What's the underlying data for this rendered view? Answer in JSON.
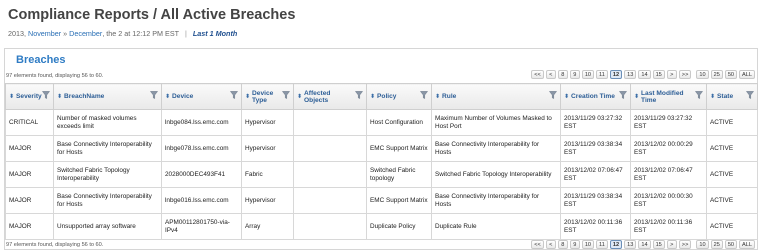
{
  "header": {
    "title": "Compliance Reports / All Active Breaches",
    "date_prefix": "2013,",
    "date_from": "November",
    "date_arrow": "»",
    "date_to": "December",
    "date_suffix": ", the 2 at 12:12 PM EST",
    "separator": "|",
    "period": "Last 1 Month"
  },
  "section": {
    "title": "Breaches"
  },
  "info": {
    "top": "97 elements found, displaying 56 to 60.",
    "bottom": "97 elements found, displaying 56 to 60."
  },
  "pager": {
    "first": "<<",
    "prev": "<",
    "pages": [
      "8",
      "9",
      "10",
      "11",
      "12",
      "13",
      "14",
      "15"
    ],
    "current": "12",
    "next": ">",
    "last": ">>",
    "sizes": [
      "10",
      "25",
      "50",
      "ALL"
    ]
  },
  "table": {
    "columns": [
      {
        "label": "Severity",
        "sort": "sorted"
      },
      {
        "label": "BreachName",
        "sort": "sortable"
      },
      {
        "label": "Device",
        "sort": "sortable"
      },
      {
        "label": "Device Type",
        "sort": "sortable"
      },
      {
        "label": "Affected Objects",
        "sort": "sortable"
      },
      {
        "label": "Policy",
        "sort": "sortable"
      },
      {
        "label": "Rule",
        "sort": "sortable"
      },
      {
        "label": "Creation Time",
        "sort": "sortable"
      },
      {
        "label": "Last Modified Time",
        "sort": "sortable"
      },
      {
        "label": "State",
        "sort": "sortable"
      }
    ],
    "rows": [
      [
        "CRITICAL",
        "Number of masked volumes exceeds limit",
        "lnbge084.lss.emc.com",
        "Hypervisor",
        "",
        "Host Configuration",
        "Maximum Number of Volumes Masked to Host Port",
        "2013/11/29 03:27:32 EST",
        "2013/11/29 03:27:32 EST",
        "ACTIVE"
      ],
      [
        "MAJOR",
        "Base Connectivity Interoperability for Hosts",
        "lnbge078.lss.emc.com",
        "Hypervisor",
        "",
        "EMC Support Matrix",
        "Base Connectivity Interoperability for Hosts",
        "2013/11/29 03:38:34 EST",
        "2013/12/02 00:00:29 EST",
        "ACTIVE"
      ],
      [
        "MAJOR",
        "Switched Fabric Topology Interoperability",
        "2028000DEC493F41",
        "Fabric",
        "",
        "Switched Fabric topology",
        "Switched Fabric Topology Interoperability",
        "2013/12/02 07:06:47 EST",
        "2013/12/02 07:06:47 EST",
        "ACTIVE"
      ],
      [
        "MAJOR",
        "Base Connectivity Interoperability for Hosts",
        "lnbge016.lss.emc.com",
        "Hypervisor",
        "",
        "EMC Support Matrix",
        "Base Connectivity Interoperability for Hosts",
        "2013/11/29 03:38:34 EST",
        "2013/12/02 00:00:30 EST",
        "ACTIVE"
      ],
      [
        "MAJOR",
        "Unsupported array software",
        "APM00112801750-via-IPv4",
        "Array",
        "",
        "Duplicate Policy",
        "Duplicate Rule",
        "2013/12/02 00:11:36 EST",
        "2013/12/02 00:11:36 EST",
        "ACTIVE"
      ]
    ]
  },
  "colors": {
    "link": "#2a6fb5",
    "section_title": "#2f7cc4",
    "header_text": "#2d5e96"
  }
}
